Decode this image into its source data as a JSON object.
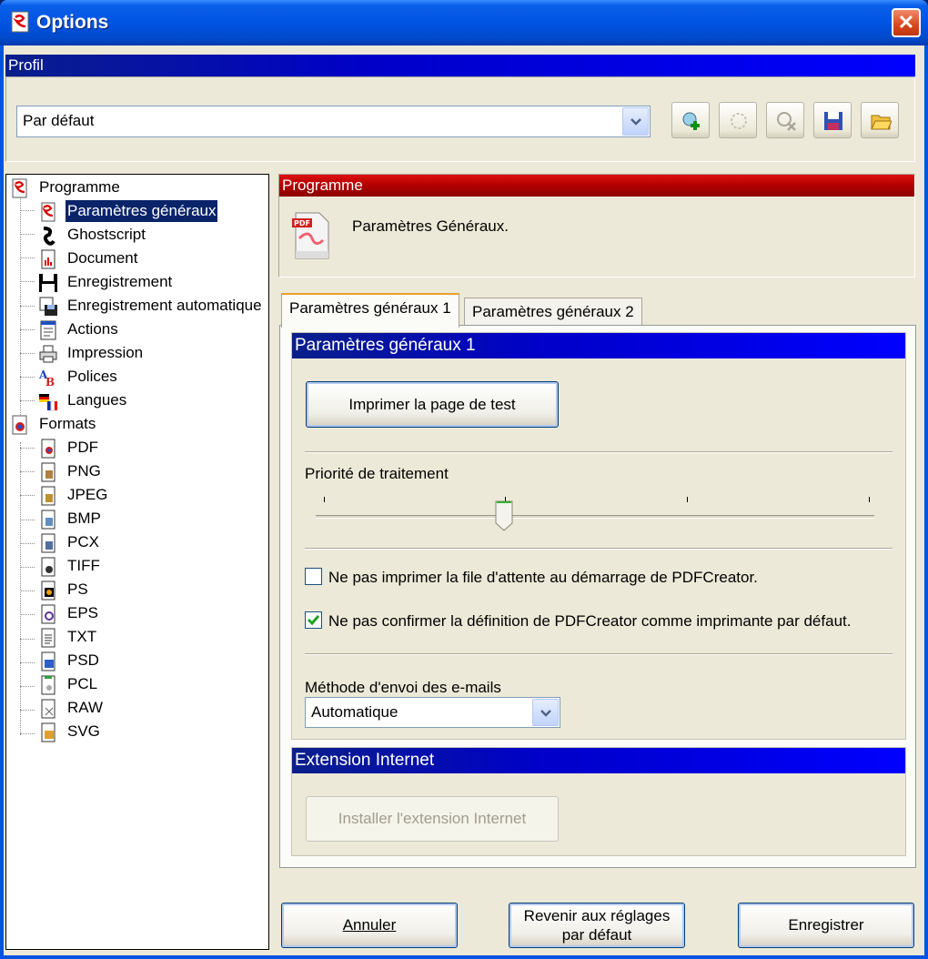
{
  "window": {
    "title": "Options",
    "close_label": "✕"
  },
  "profil": {
    "header": "Profil",
    "selected": "Par défaut",
    "tools": [
      "add-profile-icon",
      "rename-profile-icon",
      "delete-profile-icon",
      "save-profile-icon",
      "open-profile-icon"
    ]
  },
  "tree": {
    "programme": "Programme",
    "programme_items": [
      {
        "label": "Paramètres généraux",
        "icon": "pdfcreator-icon"
      },
      {
        "label": "Ghostscript",
        "icon": "ghostscript-icon"
      },
      {
        "label": "Document",
        "icon": "document-icon"
      },
      {
        "label": "Enregistrement",
        "icon": "save-icon"
      },
      {
        "label": "Enregistrement automatique",
        "icon": "autosave-icon"
      },
      {
        "label": "Actions",
        "icon": "actions-icon"
      },
      {
        "label": "Impression",
        "icon": "printer-icon"
      },
      {
        "label": "Polices",
        "icon": "fonts-icon"
      },
      {
        "label": "Langues",
        "icon": "languages-icon"
      }
    ],
    "formats": "Formats",
    "format_items": [
      "PDF",
      "PNG",
      "JPEG",
      "BMP",
      "PCX",
      "TIFF",
      "PS",
      "EPS",
      "TXT",
      "PSD",
      "PCL",
      "RAW",
      "SVG"
    ]
  },
  "right": {
    "header": "Programme",
    "description": "Paramètres Généraux.",
    "tabs": [
      "Paramètres généraux 1",
      "Paramètres généraux 2"
    ],
    "section1_title": "Paramètres généraux 1",
    "test_page_button": "Imprimer la page de test",
    "priority_label": "Priorité de traitement",
    "priority_level": 0.33,
    "checkbox1": {
      "label": "Ne pas imprimer la file d'attente au démarrage de PDFCreator.",
      "checked": false
    },
    "checkbox2": {
      "label": "Ne pas confirmer la définition de PDFCreator comme imprimante par défaut.",
      "checked": true
    },
    "email_method_label": "Méthode d'envoi des e-mails",
    "email_method_value": "Automatique",
    "section2_title": "Extension Internet",
    "install_button": "Installer l'extension Internet"
  },
  "footer": {
    "cancel": "Annuler",
    "reset_line1": "Revenir aux réglages",
    "reset_line2": "par défaut",
    "save": "Enregistrer"
  }
}
